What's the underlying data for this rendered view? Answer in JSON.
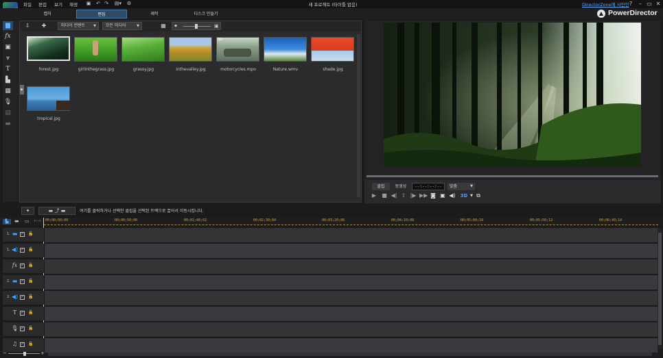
{
  "app": {
    "title": "새 프로젝트 (타이틀 없음)",
    "brand": "PowerDirector",
    "dz_link": "DirectorZone에 사인인",
    "help": "?",
    "minimize": "–",
    "maximize": "▭",
    "close": "✕"
  },
  "menu": [
    "파일",
    "편집",
    "보기",
    "재생"
  ],
  "modes": [
    {
      "label": "캡처"
    },
    {
      "label": "편집"
    },
    {
      "label": "제작"
    },
    {
      "label": "디스크 만들기"
    }
  ],
  "library": {
    "filter1": "미디어 컨텐트",
    "filter2": "모든 미디어",
    "items": [
      {
        "name": "forest.jpg",
        "icon": "image-forest"
      },
      {
        "name": "girlinthegrass.jpg",
        "icon": "image-grass-girl"
      },
      {
        "name": "grassy.jpg",
        "icon": "image-grass"
      },
      {
        "name": "inthevalley.jpg",
        "icon": "image-valley"
      },
      {
        "name": "motorcycles.mpo",
        "icon": "image-motorcycles",
        "badge": "3D"
      },
      {
        "name": "Nature.wmv",
        "icon": "video-nature"
      },
      {
        "name": "shade.jpg",
        "icon": "image-umbrella"
      },
      {
        "name": "tropical.jpg",
        "icon": "image-tropical"
      }
    ]
  },
  "preview": {
    "tab_clip": "클립",
    "tab_movie": "동영상",
    "timecode": "--:--:--:--",
    "fit": "맞춤",
    "threed": "3D"
  },
  "timeline": {
    "hint": "여기를 클릭하거나 선택한 클립을 선택된 트랙으로 끌어서 이동시킵니다.",
    "ruler": [
      "00;00;00;00",
      "00;00;50;00",
      "00;01;40;02",
      "00;02;30;04",
      "00;03;20;06",
      "00;04;10;08",
      "00;05;00;10",
      "00;05;50;12",
      "00;06;40;14"
    ],
    "tracks": [
      {
        "num": "1.",
        "icon": "video-track-icon",
        "glyph": "▬",
        "blue": true
      },
      {
        "num": "1.",
        "icon": "audio-track-icon",
        "glyph": "◀)",
        "blue": true
      },
      {
        "num": "",
        "icon": "fx-track-icon",
        "glyph": "fx",
        "blue": false
      },
      {
        "num": "2.",
        "icon": "video-track-icon",
        "glyph": "▬",
        "blue": true
      },
      {
        "num": "2.",
        "icon": "audio-track-icon",
        "glyph": "◀)",
        "blue": true
      },
      {
        "num": "",
        "icon": "title-track-icon",
        "glyph": "T",
        "blue": false
      },
      {
        "num": "",
        "icon": "voice-track-icon",
        "glyph": "🎙",
        "blue": false
      },
      {
        "num": "",
        "icon": "music-track-icon",
        "glyph": "♫",
        "blue": false
      }
    ]
  }
}
